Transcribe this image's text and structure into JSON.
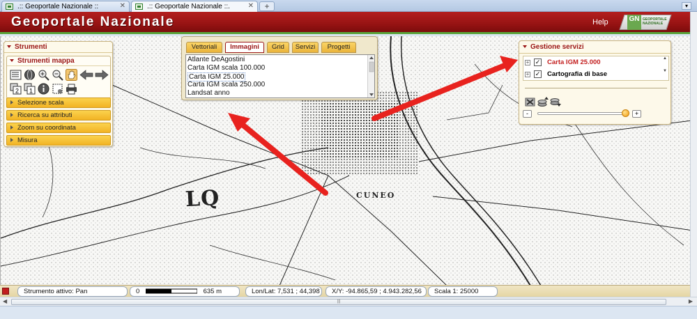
{
  "browser": {
    "tabs": [
      {
        "label": ".:: Geoportale Nazionale ::"
      },
      {
        "label": ".:: Geoportale Nazionale ::."
      }
    ],
    "new_tab": "+",
    "dropdown": "▾"
  },
  "header": {
    "title": "Geoportale Nazionale",
    "help": "Help",
    "logo_badge": "GN",
    "logo_text": "GEOPORTALE NAZIONALE"
  },
  "left_panel": {
    "title": "Strumenti",
    "subtitle": "Strumenti mappa",
    "accordion": [
      {
        "label": "Selezione scala"
      },
      {
        "label": "Ricerca su attributi"
      },
      {
        "label": "Zoom su coordinata"
      },
      {
        "label": "Misura"
      }
    ],
    "tool_icons": [
      "legend-icon",
      "globe-icon",
      "zoom-in-icon",
      "zoom-out-icon",
      "pan-hand-icon",
      "back-arrow-icon",
      "forward-arrow-icon",
      "layers-2-icon",
      "layers-1-icon",
      "info-icon",
      "zoom-box-icon",
      "print-icon"
    ]
  },
  "image_panel": {
    "tabs": [
      {
        "label": "Vettoriali"
      },
      {
        "label": "Immagini",
        "active": true
      },
      {
        "label": "Grid"
      },
      {
        "label": "Servizi"
      },
      {
        "label": "Progetti"
      }
    ],
    "list": [
      {
        "label": "Atlante DeAgostini"
      },
      {
        "label": "Carta IGM scala 100.000"
      },
      {
        "label": "Carta IGM 25.000",
        "selected": true
      },
      {
        "label": "Carta IGM scala 250.000"
      },
      {
        "label": "Landsat anno"
      }
    ]
  },
  "right_panel": {
    "title": "Gestione servizi",
    "layers": [
      {
        "label": "Carta IGM 25.000",
        "checked": true,
        "color": "#c21e1e"
      },
      {
        "label": "Cartografia di base",
        "checked": true,
        "color": "#111111"
      }
    ],
    "slider": {
      "minus": "-",
      "plus": "+",
      "value_fraction": 0.98
    }
  },
  "map": {
    "labels": {
      "lq": "LQ",
      "city": "CUNEO"
    },
    "arrow_color": "#e8221e"
  },
  "status": {
    "tool": "Strumento attivo: Pan",
    "scale_start": "0",
    "scale_end": "635 m",
    "lonlat": "Lon/Lat: 7,531 ; 44,398",
    "xy": "X/Y: -94.865,59 ; 4.943.282,56",
    "scale": "Scala 1: 25000"
  }
}
